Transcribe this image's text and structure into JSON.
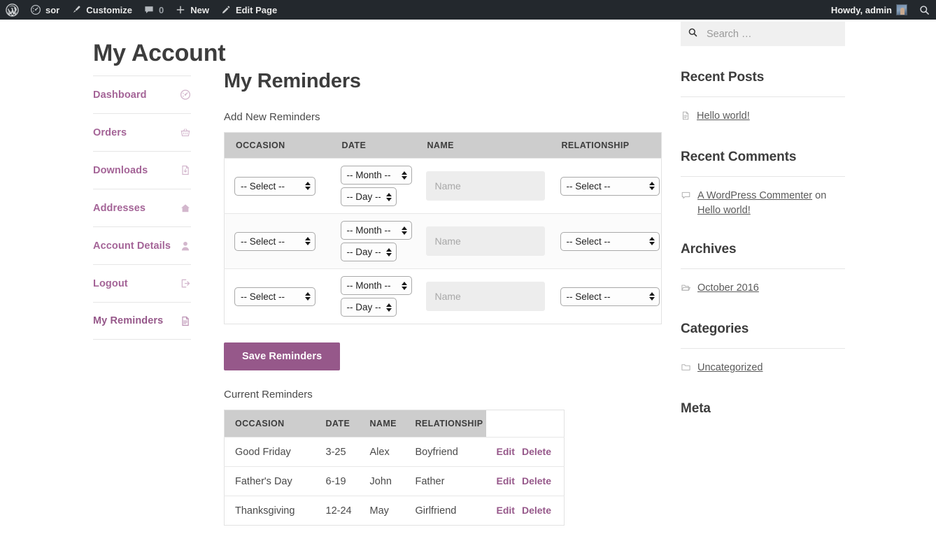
{
  "adminbar": {
    "wp_logo_icon": "wordpress-logo-icon",
    "site_icon": "dashboard-speedometer-icon",
    "site_name": "sor",
    "customize_icon": "paintbrush-icon",
    "customize_label": "Customize",
    "comments_icon": "comment-bubble-icon",
    "comments_count": "0",
    "new_icon": "plus-icon",
    "new_label": "New",
    "edit_icon": "pencil-icon",
    "edit_label": "Edit Page",
    "howdy": "Howdy, admin",
    "avatar_icon": "user-avatar",
    "search_icon": "search-icon"
  },
  "page": {
    "title": "My Account"
  },
  "account_nav": {
    "items": [
      {
        "label": "Dashboard",
        "icon": "speedometer-icon",
        "active": false
      },
      {
        "label": "Orders",
        "icon": "basket-icon",
        "active": false
      },
      {
        "label": "Downloads",
        "icon": "download-file-icon",
        "active": false
      },
      {
        "label": "Addresses",
        "icon": "home-icon",
        "active": false
      },
      {
        "label": "Account Details",
        "icon": "person-icon",
        "active": false
      },
      {
        "label": "Logout",
        "icon": "logout-arrow-icon",
        "active": false
      },
      {
        "label": "My Reminders",
        "icon": "document-icon",
        "active": true
      }
    ]
  },
  "reminders": {
    "heading": "My Reminders",
    "add_label": "Add New Reminders",
    "form_headers": [
      "OCCASION",
      "DATE",
      "NAME",
      "RELATIONSHIP"
    ],
    "form_rows": [
      {
        "occasion": "-- Select --",
        "month": "-- Month --",
        "day": "-- Day --",
        "name_value": "",
        "name_placeholder": "Name",
        "relationship": "-- Select --"
      },
      {
        "occasion": "-- Select --",
        "month": "-- Month --",
        "day": "-- Day --",
        "name_value": "",
        "name_placeholder": "Name",
        "relationship": "-- Select --"
      },
      {
        "occasion": "-- Select --",
        "month": "-- Month --",
        "day": "-- Day --",
        "name_value": "",
        "name_placeholder": "Name",
        "relationship": "-- Select --"
      }
    ],
    "save_label": "Save Reminders",
    "current_label": "Current Reminders",
    "current_headers": [
      "OCCASION",
      "DATE",
      "NAME",
      "RELATIONSHIP",
      ""
    ],
    "current_rows": [
      {
        "occasion": "Good Friday",
        "date": "3-25",
        "name": "Alex",
        "relationship": "Boyfriend",
        "edit": "Edit",
        "delete": "Delete"
      },
      {
        "occasion": "Father's Day",
        "date": "6-19",
        "name": "John",
        "relationship": "Father",
        "edit": "Edit",
        "delete": "Delete"
      },
      {
        "occasion": "Thanksgiving",
        "date": "12-24",
        "name": "May",
        "relationship": "Girlfriend",
        "edit": "Edit",
        "delete": "Delete"
      }
    ]
  },
  "sidebar": {
    "search": {
      "placeholder": "Search …",
      "value": "",
      "icon": "search-icon"
    },
    "widgets": [
      {
        "title": "Recent Posts",
        "items": [
          {
            "icon": "document-icon",
            "text": "Hello world!"
          }
        ]
      },
      {
        "title": "Recent Comments",
        "items": [
          {
            "icon": "comment-bubble-icon",
            "author": "A WordPress Commenter",
            "on": "on",
            "post": "Hello world!"
          }
        ]
      },
      {
        "title": "Archives",
        "items": [
          {
            "icon": "open-folder-icon",
            "text": "October 2016"
          }
        ]
      },
      {
        "title": "Categories",
        "items": [
          {
            "icon": "folder-icon",
            "text": "Uncategorized"
          }
        ]
      },
      {
        "title": "Meta",
        "items": []
      }
    ]
  },
  "colors": {
    "accent_purple": "#96588a",
    "nav_purple": "#a46497",
    "adminbar_bg": "#23282d",
    "table_header_bg": "#cdcdcd",
    "input_bg": "#ededed"
  }
}
